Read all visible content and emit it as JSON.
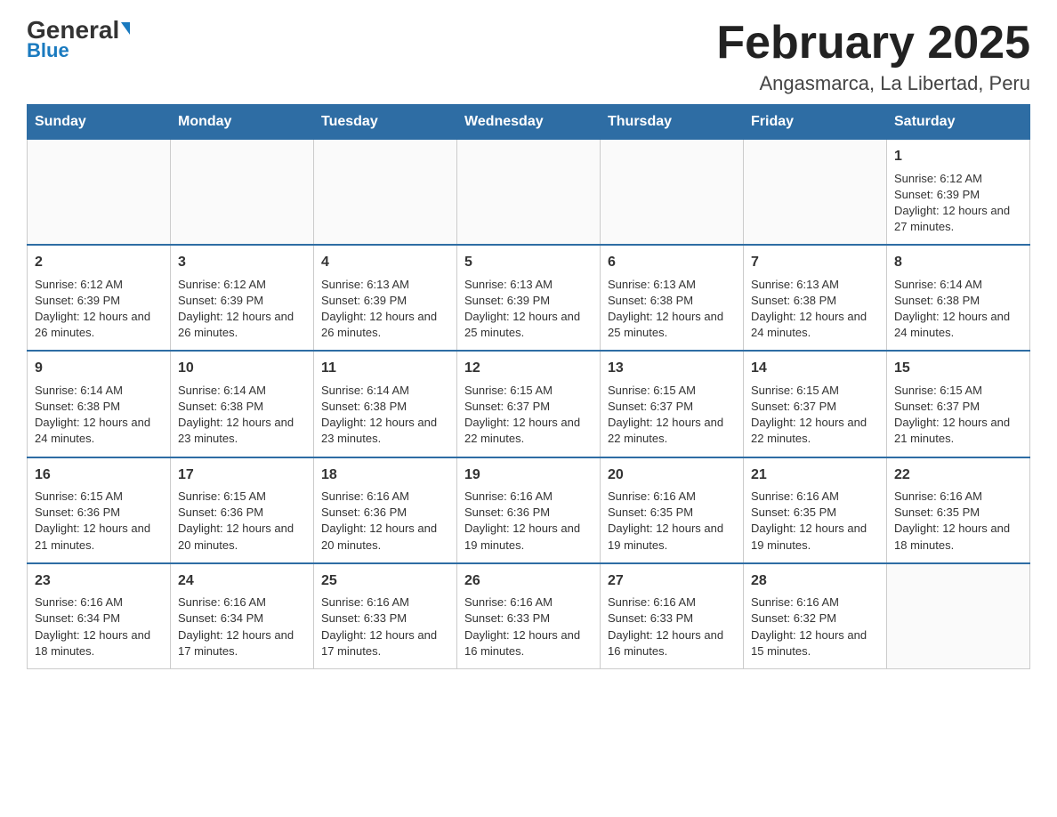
{
  "header": {
    "logo_general": "General",
    "logo_blue": "Blue",
    "month_title": "February 2025",
    "location": "Angasmarca, La Libertad, Peru"
  },
  "weekdays": [
    "Sunday",
    "Monday",
    "Tuesday",
    "Wednesday",
    "Thursday",
    "Friday",
    "Saturday"
  ],
  "weeks": [
    [
      {
        "day": "",
        "info": ""
      },
      {
        "day": "",
        "info": ""
      },
      {
        "day": "",
        "info": ""
      },
      {
        "day": "",
        "info": ""
      },
      {
        "day": "",
        "info": ""
      },
      {
        "day": "",
        "info": ""
      },
      {
        "day": "1",
        "info": "Sunrise: 6:12 AM\nSunset: 6:39 PM\nDaylight: 12 hours and 27 minutes."
      }
    ],
    [
      {
        "day": "2",
        "info": "Sunrise: 6:12 AM\nSunset: 6:39 PM\nDaylight: 12 hours and 26 minutes."
      },
      {
        "day": "3",
        "info": "Sunrise: 6:12 AM\nSunset: 6:39 PM\nDaylight: 12 hours and 26 minutes."
      },
      {
        "day": "4",
        "info": "Sunrise: 6:13 AM\nSunset: 6:39 PM\nDaylight: 12 hours and 26 minutes."
      },
      {
        "day": "5",
        "info": "Sunrise: 6:13 AM\nSunset: 6:39 PM\nDaylight: 12 hours and 25 minutes."
      },
      {
        "day": "6",
        "info": "Sunrise: 6:13 AM\nSunset: 6:38 PM\nDaylight: 12 hours and 25 minutes."
      },
      {
        "day": "7",
        "info": "Sunrise: 6:13 AM\nSunset: 6:38 PM\nDaylight: 12 hours and 24 minutes."
      },
      {
        "day": "8",
        "info": "Sunrise: 6:14 AM\nSunset: 6:38 PM\nDaylight: 12 hours and 24 minutes."
      }
    ],
    [
      {
        "day": "9",
        "info": "Sunrise: 6:14 AM\nSunset: 6:38 PM\nDaylight: 12 hours and 24 minutes."
      },
      {
        "day": "10",
        "info": "Sunrise: 6:14 AM\nSunset: 6:38 PM\nDaylight: 12 hours and 23 minutes."
      },
      {
        "day": "11",
        "info": "Sunrise: 6:14 AM\nSunset: 6:38 PM\nDaylight: 12 hours and 23 minutes."
      },
      {
        "day": "12",
        "info": "Sunrise: 6:15 AM\nSunset: 6:37 PM\nDaylight: 12 hours and 22 minutes."
      },
      {
        "day": "13",
        "info": "Sunrise: 6:15 AM\nSunset: 6:37 PM\nDaylight: 12 hours and 22 minutes."
      },
      {
        "day": "14",
        "info": "Sunrise: 6:15 AM\nSunset: 6:37 PM\nDaylight: 12 hours and 22 minutes."
      },
      {
        "day": "15",
        "info": "Sunrise: 6:15 AM\nSunset: 6:37 PM\nDaylight: 12 hours and 21 minutes."
      }
    ],
    [
      {
        "day": "16",
        "info": "Sunrise: 6:15 AM\nSunset: 6:36 PM\nDaylight: 12 hours and 21 minutes."
      },
      {
        "day": "17",
        "info": "Sunrise: 6:15 AM\nSunset: 6:36 PM\nDaylight: 12 hours and 20 minutes."
      },
      {
        "day": "18",
        "info": "Sunrise: 6:16 AM\nSunset: 6:36 PM\nDaylight: 12 hours and 20 minutes."
      },
      {
        "day": "19",
        "info": "Sunrise: 6:16 AM\nSunset: 6:36 PM\nDaylight: 12 hours and 19 minutes."
      },
      {
        "day": "20",
        "info": "Sunrise: 6:16 AM\nSunset: 6:35 PM\nDaylight: 12 hours and 19 minutes."
      },
      {
        "day": "21",
        "info": "Sunrise: 6:16 AM\nSunset: 6:35 PM\nDaylight: 12 hours and 19 minutes."
      },
      {
        "day": "22",
        "info": "Sunrise: 6:16 AM\nSunset: 6:35 PM\nDaylight: 12 hours and 18 minutes."
      }
    ],
    [
      {
        "day": "23",
        "info": "Sunrise: 6:16 AM\nSunset: 6:34 PM\nDaylight: 12 hours and 18 minutes."
      },
      {
        "day": "24",
        "info": "Sunrise: 6:16 AM\nSunset: 6:34 PM\nDaylight: 12 hours and 17 minutes."
      },
      {
        "day": "25",
        "info": "Sunrise: 6:16 AM\nSunset: 6:33 PM\nDaylight: 12 hours and 17 minutes."
      },
      {
        "day": "26",
        "info": "Sunrise: 6:16 AM\nSunset: 6:33 PM\nDaylight: 12 hours and 16 minutes."
      },
      {
        "day": "27",
        "info": "Sunrise: 6:16 AM\nSunset: 6:33 PM\nDaylight: 12 hours and 16 minutes."
      },
      {
        "day": "28",
        "info": "Sunrise: 6:16 AM\nSunset: 6:32 PM\nDaylight: 12 hours and 15 minutes."
      },
      {
        "day": "",
        "info": ""
      }
    ]
  ]
}
